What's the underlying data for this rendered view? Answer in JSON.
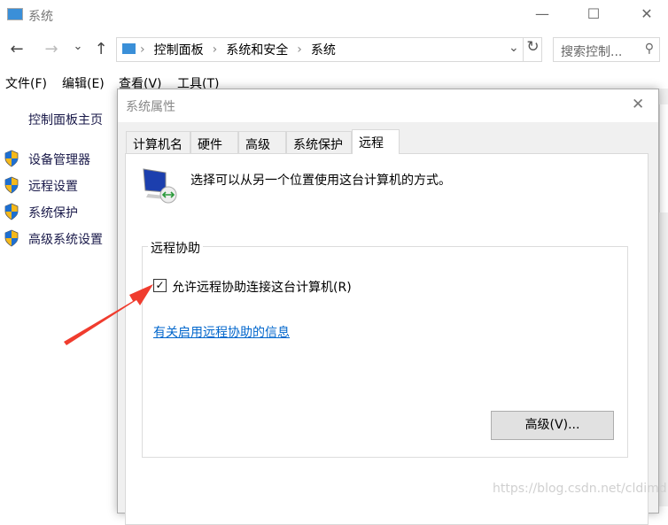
{
  "window": {
    "title": "系统",
    "minimize": "—",
    "maximize": "☐",
    "close": "✕"
  },
  "nav": {
    "back": "←",
    "forward": "→",
    "recent": "⌄",
    "up": "↑",
    "refresh": "↻",
    "dropdown": "⌄"
  },
  "breadcrumb": [
    "控制面板",
    "系统和安全",
    "系统"
  ],
  "search": {
    "placeholder": "搜索控制..."
  },
  "menu": [
    "文件(F)",
    "编辑(E)",
    "查看(V)",
    "工具(T)"
  ],
  "sidebar": {
    "home": "控制面板主页",
    "items": [
      "设备管理器",
      "远程设置",
      "系统保护",
      "高级系统设置"
    ]
  },
  "dialog": {
    "title": "系统属性",
    "tabs": [
      "计算机名",
      "硬件",
      "高级",
      "系统保护",
      "远程"
    ],
    "active_tab": "远程",
    "description": "选择可以从另一个位置使用这台计算机的方式。",
    "group_title": "远程协助",
    "checkbox_label": "允许远程协助连接这台计算机(R)",
    "checkbox_checked": true,
    "link": "有关启用远程协助的信息",
    "advanced_button": "高级(V)..."
  },
  "watermark": "https://blog.csdn.net/cldimd",
  "colors": {
    "link": "#0066cc",
    "arrow": "#f03c2e"
  }
}
